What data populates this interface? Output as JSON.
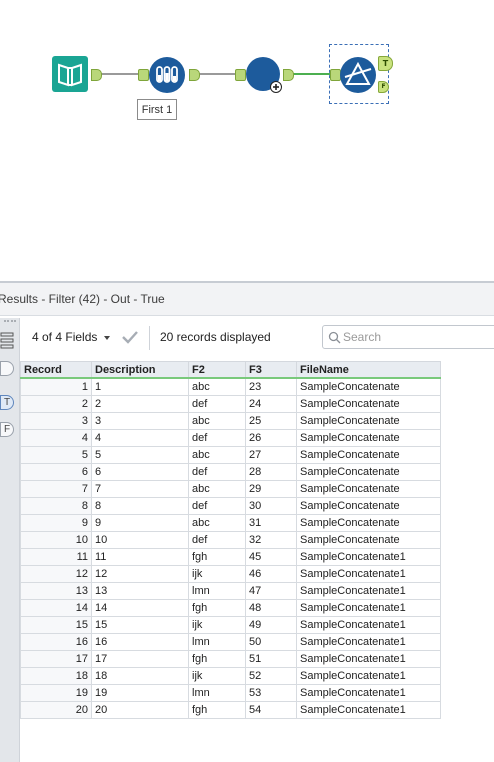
{
  "workflow": {
    "annotation": "First 1",
    "anchors": {
      "filter_true": "T",
      "filter_false": "F"
    }
  },
  "results": {
    "title": "Results - Filter (42) - Out - True",
    "rail": {
      "true_label": "T",
      "false_label": "F"
    },
    "toolbar": {
      "fields_label": "4 of 4 Fields",
      "records_label": "20 records displayed",
      "search_placeholder": "Search"
    },
    "columns": [
      "Record",
      "Description",
      "F2",
      "F3",
      "FileName"
    ],
    "rows": [
      [
        "1",
        "1",
        "abc",
        "23",
        "SampleConcatenate"
      ],
      [
        "2",
        "2",
        "def",
        "24",
        "SampleConcatenate"
      ],
      [
        "3",
        "3",
        "abc",
        "25",
        "SampleConcatenate"
      ],
      [
        "4",
        "4",
        "def",
        "26",
        "SampleConcatenate"
      ],
      [
        "5",
        "5",
        "abc",
        "27",
        "SampleConcatenate"
      ],
      [
        "6",
        "6",
        "def",
        "28",
        "SampleConcatenate"
      ],
      [
        "7",
        "7",
        "abc",
        "29",
        "SampleConcatenate"
      ],
      [
        "8",
        "8",
        "def",
        "30",
        "SampleConcatenate"
      ],
      [
        "9",
        "9",
        "abc",
        "31",
        "SampleConcatenate"
      ],
      [
        "10",
        "10",
        "def",
        "32",
        "SampleConcatenate"
      ],
      [
        "11",
        "11",
        "fgh",
        "45",
        "SampleConcatenate1"
      ],
      [
        "12",
        "12",
        "ijk",
        "46",
        "SampleConcatenate1"
      ],
      [
        "13",
        "13",
        "lmn",
        "47",
        "SampleConcatenate1"
      ],
      [
        "14",
        "14",
        "fgh",
        "48",
        "SampleConcatenate1"
      ],
      [
        "15",
        "15",
        "ijk",
        "49",
        "SampleConcatenate1"
      ],
      [
        "16",
        "16",
        "lmn",
        "50",
        "SampleConcatenate1"
      ],
      [
        "17",
        "17",
        "fgh",
        "51",
        "SampleConcatenate1"
      ],
      [
        "18",
        "18",
        "ijk",
        "52",
        "SampleConcatenate1"
      ],
      [
        "19",
        "19",
        "lmn",
        "53",
        "SampleConcatenate1"
      ],
      [
        "20",
        "20",
        "fgh",
        "54",
        "SampleConcatenate1"
      ]
    ]
  },
  "colors": {
    "input_tool": "#1aa594",
    "select_tool": "#1d5b9c",
    "formula_tool": "#1d5b9c",
    "filter_tool": "#1d5b9c",
    "anchor": "#b9d77a",
    "header_underline": "#79c97b"
  },
  "icons": {
    "input_tool": "book-icon",
    "select_tool": "test-tubes-icon",
    "formula_tool": "circle-add-icon",
    "filter_tool": "filter-triangle-icon",
    "check": "checkmark-icon",
    "search": "search-icon"
  }
}
